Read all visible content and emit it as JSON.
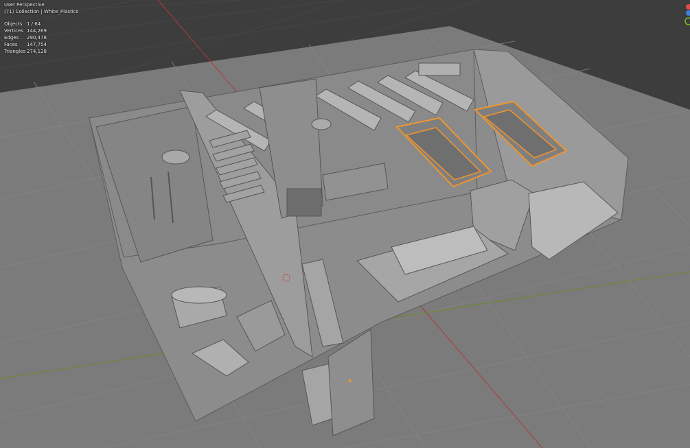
{
  "viewport": {
    "mode": "User Perspective",
    "context": "(71) Collection | White_Plastics"
  },
  "stats": [
    {
      "label": "Objects",
      "value": "1 / 64"
    },
    {
      "label": "Vertices",
      "value": "144,269"
    },
    {
      "label": "Edges",
      "value": "290,478"
    },
    {
      "label": "Faces",
      "value": "147,754"
    },
    {
      "label": "Triangles",
      "value": "274,128"
    }
  ],
  "colors": {
    "background": "#3d3d3d",
    "floor": "#7b7b7b",
    "selection_outline": "#f0952e",
    "x_axis": "#b03a3a",
    "y_axis": "#6b8a2a",
    "gizmo_x": "#e04b4b",
    "gizmo_y": "#78b82a",
    "gizmo_z": "#3f7fd8"
  },
  "gizmo": {
    "axes": [
      "x",
      "y",
      "z"
    ]
  }
}
